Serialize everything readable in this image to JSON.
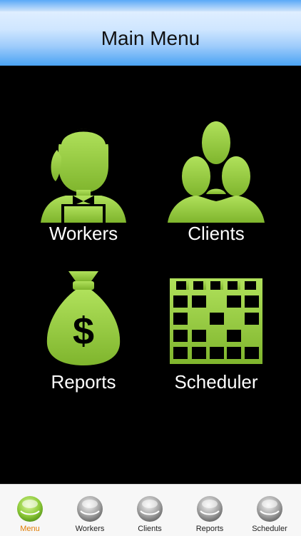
{
  "header": {
    "title": "Main Menu"
  },
  "tiles": [
    {
      "label": "Workers",
      "icon": "worker-icon"
    },
    {
      "label": "Clients",
      "icon": "clients-icon"
    },
    {
      "label": "Reports",
      "icon": "money-bag-icon"
    },
    {
      "label": "Scheduler",
      "icon": "calendar-grid-icon"
    }
  ],
  "tabbar": {
    "tabs": [
      {
        "label": "Menu",
        "active": true,
        "icon": "green-ball-icon"
      },
      {
        "label": "Workers",
        "active": false,
        "icon": "gray-ball-icon"
      },
      {
        "label": "Clients",
        "active": false,
        "icon": "gray-ball-icon"
      },
      {
        "label": "Reports",
        "active": false,
        "icon": "gray-ball-icon"
      },
      {
        "label": "Scheduler",
        "active": false,
        "icon": "gray-ball-icon"
      }
    ]
  },
  "colors": {
    "accent_green": "#8cc63f",
    "active_tab": "#e07b00",
    "header_blue": "#4aa3f3"
  },
  "icons": {
    "money_symbol": "$"
  }
}
